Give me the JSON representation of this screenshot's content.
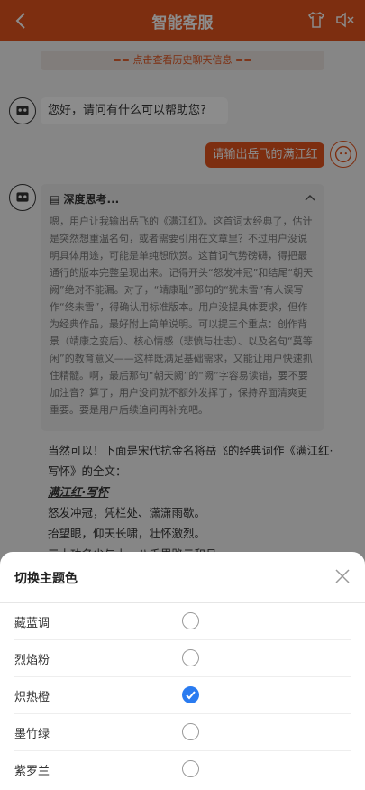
{
  "header": {
    "title": "智能客服"
  },
  "chat": {
    "history_link": "== 点击查看历史聊天信息 ==",
    "bot_greeting": "您好，请问有什么可以帮助您?",
    "user_message": "请输出岳飞的满江红",
    "thinking": {
      "label": "深度思考...",
      "text": "嗯，用户让我输出岳飞的《满江红》。这首词太经典了，估计是突然想重温名句，或者需要引用在文章里？不过用户没说明具体用途，可能是单纯想欣赏。这首词气势磅礴，得把最通行的版本完整呈现出来。记得开头“怒发冲冠”和结尾“朝天阙”绝对不能漏。对了，“靖康耻”那句的“犹未雪”有人误写作“终未雪”，得确认用标准版本。用户没提具体要求，但作为经典作品，最好附上简单说明。可以提三个重点：创作背景（靖康之变后）、核心情感（悲愤与壮志）、以及名句“莫等闲”的教育意义——这样既满足基础需求，又能让用户快速抓住精髓。啊，最后那句“朝天阙”的“阙”字容易读错，要不要加注音？算了，用户没问就不额外发挥了，保持界面清爽更重要。要是用户后续追问再补充吧。"
    },
    "answer": {
      "intro": "当然可以！下面是宋代抗金名将岳飞的经典词作《满江红·写怀》的全文：",
      "poem_title": "满江红·写怀",
      "lines": [
        "怒发冲冠，凭栏处、潇潇雨歇。",
        "抬望眼，仰天长啸，壮怀激烈。",
        "三十功名尘与土，八千里路云和月。"
      ]
    }
  },
  "theme_sheet": {
    "title": "切换主题色",
    "options": [
      {
        "label": "藏蓝调",
        "selected": false
      },
      {
        "label": "烈焰粉",
        "selected": false
      },
      {
        "label": "炽热橙",
        "selected": true
      },
      {
        "label": "墨竹绿",
        "selected": false
      },
      {
        "label": "紫罗兰",
        "selected": false
      }
    ]
  },
  "colors": {
    "accent": "#E4551E",
    "check": "#2A7BF0"
  },
  "icons": {
    "back": "back-arrow-icon",
    "theme": "shirt-icon",
    "sound": "speaker-mute-icon",
    "close": "close-icon",
    "bot": "robot-avatar-icon",
    "user": "user-avatar-icon"
  }
}
